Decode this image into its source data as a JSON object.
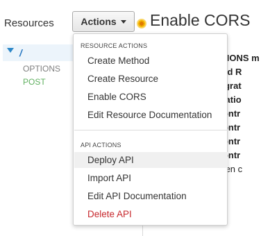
{
  "sidebar": {
    "title": "Resources",
    "tree": {
      "root": "/",
      "methods": [
        "OPTIONS",
        "POST"
      ]
    }
  },
  "toolbar": {
    "actions_label": "Actions"
  },
  "page": {
    "title": "Enable CORS",
    "content_fragments": [
      "OPTIONS m",
      "ethod R",
      "integrat",
      "tegratio",
      "s-Contr",
      "s-Contr",
      "s-Contr",
      "s-Contr",
      "s been c"
    ]
  },
  "menu": {
    "resource_header": "RESOURCE ACTIONS",
    "resource_items": [
      "Create Method",
      "Create Resource",
      "Enable CORS",
      "Edit Resource Documentation"
    ],
    "api_header": "API ACTIONS",
    "api_items": [
      "Deploy API",
      "Import API",
      "Edit API Documentation"
    ],
    "danger_item": "Delete API"
  },
  "colors": {
    "link_blue": "#2a79c2",
    "post_green": "#60b060",
    "danger_red": "#c7282d",
    "hover_bg": "#f0f0f0"
  }
}
